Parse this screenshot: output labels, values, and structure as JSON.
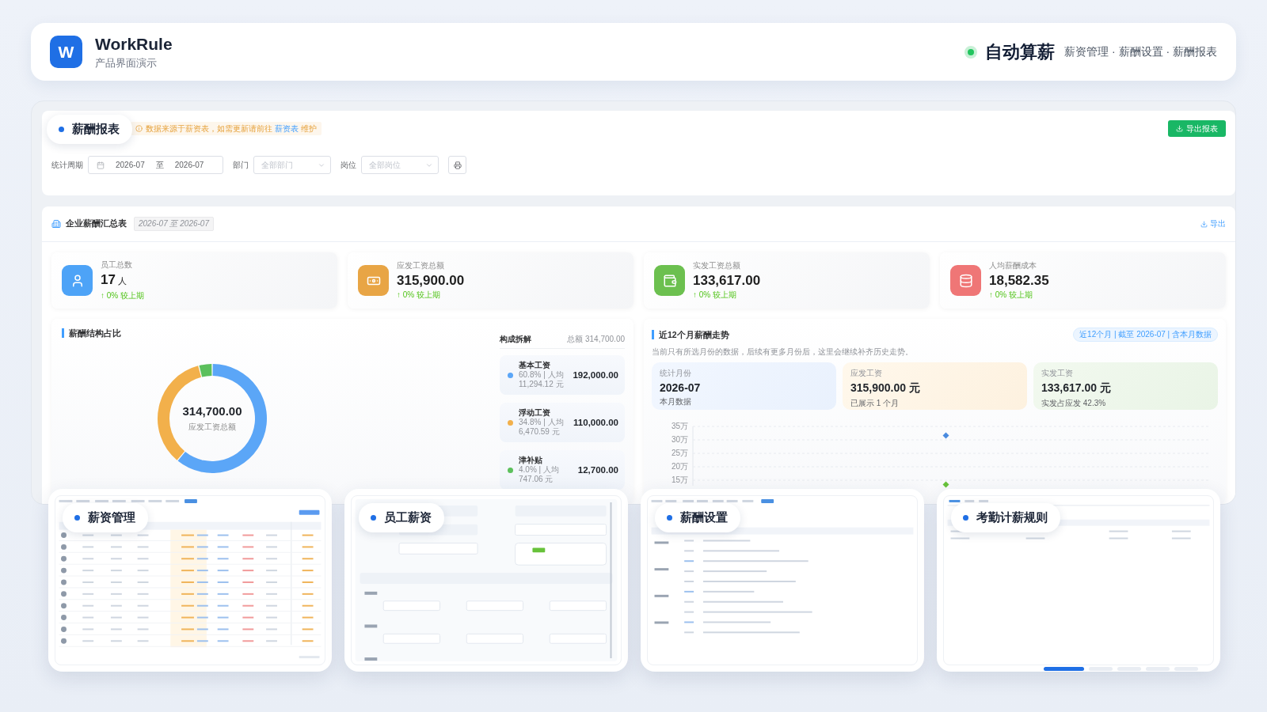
{
  "header": {
    "logo": "W",
    "title": "WorkRule",
    "subtitle": "产品界面演示",
    "headline": "自动算薪",
    "sections": "薪资管理 · 薪酬设置 · 薪酬报表"
  },
  "report_preview": {
    "label": "薪酬报表",
    "notice": {
      "text": "数据来源于薪资表，如需更新请前往",
      "link": "薪资表",
      "text_after": "维护"
    },
    "export_button": "导出报表",
    "filters": [
      {
        "kind": "daterange",
        "label": "统计周期",
        "start": "2026-07",
        "separator": "至",
        "end": "2026-07"
      },
      {
        "kind": "select",
        "label": "部门",
        "placeholder": "全部部门"
      },
      {
        "kind": "select",
        "label": "岗位",
        "placeholder": "全部岗位"
      }
    ],
    "summary": {
      "title": "企业薪酬汇总表",
      "period": "2026-07 至 2026-07",
      "export_link": "导出",
      "stats": [
        {
          "kind": "people",
          "color": "#4da3f7",
          "label": "员工总数",
          "value": "17",
          "unit": "人",
          "change": "↑ 0% 较上期"
        },
        {
          "kind": "money",
          "color": "#e8a545",
          "label": "应发工资总额",
          "value": "315,900.00",
          "change": "↑ 0% 较上期"
        },
        {
          "kind": "wallet",
          "color": "#6cc04f",
          "label": "实发工资总额",
          "value": "133,617.00",
          "change": "↑ 0% 较上期"
        },
        {
          "kind": "coins",
          "color": "#ef7676",
          "label": "人均薪酬成本",
          "value": "18,582.35",
          "change": "↑ 0% 较上期"
        }
      ]
    },
    "structure": {
      "title": "薪酬结构占比",
      "center_value": "314,700.00",
      "center_label": "应发工资总额",
      "chart_data": {
        "type": "donut",
        "values": [
          61,
          35,
          4
        ]
      },
      "breakdown": {
        "title": "构成拆解",
        "total": "总额 314,700.00",
        "items": [
          {
            "name": "基本工资",
            "color": "#5ba6f7",
            "detail": "60.8% | 人均 11,294.12 元",
            "amount": "192,000.00"
          },
          {
            "name": "浮动工资",
            "color": "#f2b04b",
            "detail": "34.8% | 人均 6,470.59 元",
            "amount": "110,000.00"
          },
          {
            "name": "津补贴",
            "color": "#5cc05c",
            "detail": "4.0% | 人均 747.06 元",
            "amount": "12,700.00"
          }
        ]
      }
    },
    "trend": {
      "title": "近12个月薪酬走势",
      "scope": "近12个月 | 截至 2026-07 | 含本月数据",
      "note": "当前只有所选月份的数据，后续有更多月份后，这里会继续补齐历史走势。",
      "cards": [
        {
          "kind": "month",
          "label": "统计月份",
          "value": "2026-07",
          "caption": "本月数据"
        },
        {
          "kind": "gross",
          "label": "应发工资",
          "value": "315,900.00 元",
          "caption": "已展示 1 个月"
        },
        {
          "kind": "net",
          "label": "实发工资",
          "value": "133,617.00 元",
          "caption": "实发占应发 42.3%"
        }
      ],
      "chart_data": {
        "type": "line",
        "grid": true,
        "ylim": [
          13,
          35
        ],
        "yticks": [
          {
            "value": 35,
            "label": "35万"
          },
          {
            "value": 30,
            "label": "30万"
          },
          {
            "value": 25,
            "label": "25万"
          },
          {
            "value": 20,
            "label": "20万"
          },
          {
            "value": 15,
            "label": "15万"
          }
        ],
        "series": [
          {
            "color": "#4a8bdf",
            "marker": "diamond",
            "values": [
              31.6
            ]
          },
          {
            "color": "#67c23a",
            "marker": "diamond",
            "values": [
              13.4
            ]
          }
        ]
      }
    }
  },
  "previews": [
    {
      "kind": "table",
      "label": "薪资管理"
    },
    {
      "kind": "form",
      "label": "员工薪资"
    },
    {
      "kind": "settings",
      "label": "薪酬设置"
    },
    {
      "kind": "list",
      "label": "考勤计薪规则"
    }
  ],
  "pager": [
    {
      "selected": true
    },
    {
      "selected": false
    },
    {
      "selected": false
    },
    {
      "selected": false
    },
    {
      "selected": false
    }
  ]
}
